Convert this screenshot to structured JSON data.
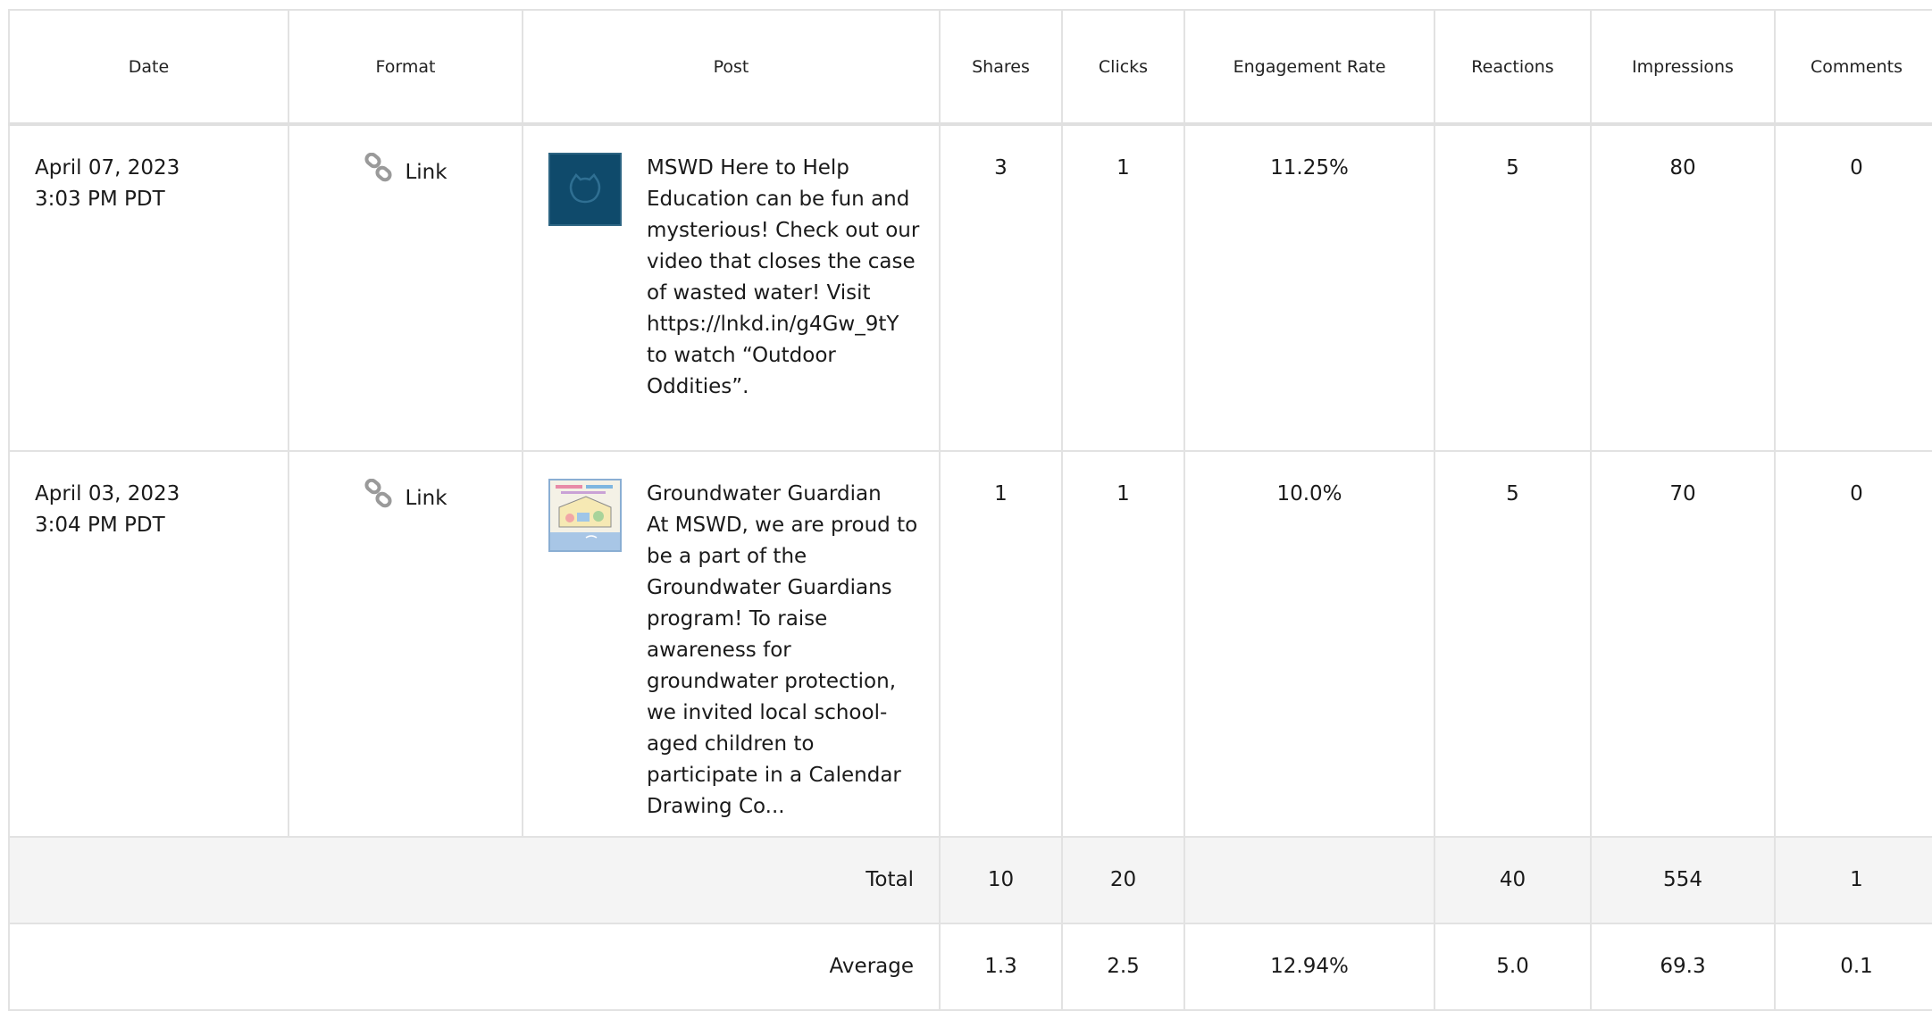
{
  "columns": {
    "date": "Date",
    "format": "Format",
    "post": "Post",
    "shares": "Shares",
    "clicks": "Clicks",
    "engagement_rate": "Engagement Rate",
    "reactions": "Reactions",
    "impressions": "Impressions",
    "comments": "Comments"
  },
  "rows": [
    {
      "date": "April 07, 2023",
      "time": "3:03 PM PDT",
      "format": "Link",
      "format_icon": "link-icon",
      "thumbnail": "logo-thumbnail",
      "post": "MSWD Here to Help Education can be fun and mysterious! Check out our video that closes the case of wasted water! Visit https://lnkd.in/g4Gw_9tY to watch “Outdoor Oddities”.",
      "shares": "3",
      "clicks": "1",
      "engagement_rate": "11.25%",
      "reactions": "5",
      "impressions": "80",
      "comments": "0"
    },
    {
      "date": "April 03, 2023",
      "time": "3:04 PM PDT",
      "format": "Link",
      "format_icon": "link-icon",
      "thumbnail": "drawing-thumbnail",
      "post_title": "Groundwater Guardian",
      "post": "At MSWD, we are proud to be a part of the Groundwater Guardians program! To raise awareness for groundwater protection, we invited local school-aged children to participate in a Calendar Drawing Co...",
      "shares": "1",
      "clicks": "1",
      "engagement_rate": "10.0%",
      "reactions": "5",
      "impressions": "70",
      "comments": "0"
    }
  ],
  "total": {
    "label": "Total",
    "shares": "10",
    "clicks": "20",
    "engagement_rate": "",
    "reactions": "40",
    "impressions": "554",
    "comments": "1"
  },
  "average": {
    "label": "Average",
    "shares": "1.3",
    "clicks": "2.5",
    "engagement_rate": "12.94%",
    "reactions": "5.0",
    "impressions": "69.3",
    "comments": "0.1"
  },
  "colors": {
    "border": "#e2e2e2",
    "total_row_bg": "#f4f4f4",
    "thumb1_bg": "#0f4a6b",
    "icon_gray": "#9a9a9a"
  }
}
